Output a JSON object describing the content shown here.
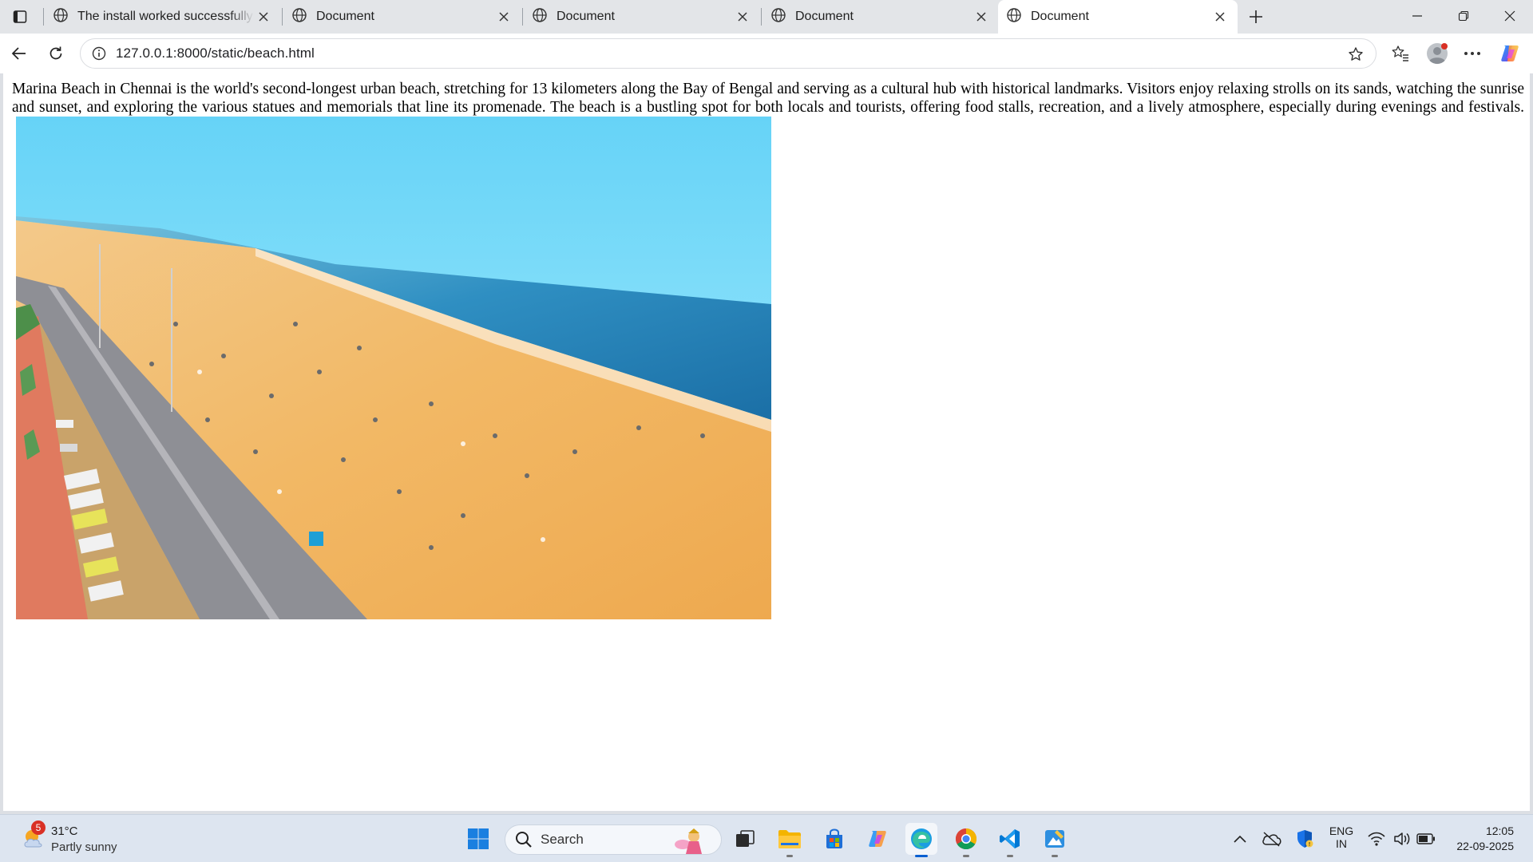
{
  "browser": {
    "tabs": [
      {
        "title": "The install worked successfully! Congratulations!",
        "active": false
      },
      {
        "title": "Document",
        "active": false
      },
      {
        "title": "Document",
        "active": false
      },
      {
        "title": "Document",
        "active": false
      },
      {
        "title": "Document",
        "active": true
      }
    ],
    "address": {
      "url": "127.0.0.1:8000/static/beach.html"
    }
  },
  "page": {
    "paragraph": "Marina Beach in Chennai is the world's second-longest urban beach, stretching for 13 kilometers along the Bay of Bengal and serving as a cultural hub with historical landmarks. Visitors enjoy relaxing strolls on its sands, watching the sunrise and sunset, and exploring the various statues and memorials that line its promenade. The beach is a bustling spot for both locals and tourists, offering food stalls, recreation, and a lively atmosphere, especially during evenings and festivals.",
    "image": {
      "alt": "Aerial view of Marina Beach",
      "subject": "aerial beach photo with sea, sand, road and parked buses"
    }
  },
  "taskbar": {
    "weather": {
      "badge": "5",
      "temp": "31°C",
      "condition": "Partly sunny"
    },
    "search": {
      "label": "Search"
    },
    "tray": {
      "lang_top": "ENG",
      "lang_bottom": "IN",
      "time": "12:05",
      "date": "22-09-2025"
    }
  },
  "colors": {
    "tabstrip": "#e3e5e8",
    "taskbar": "#dde5f0",
    "accent": "#0a5fd1"
  }
}
